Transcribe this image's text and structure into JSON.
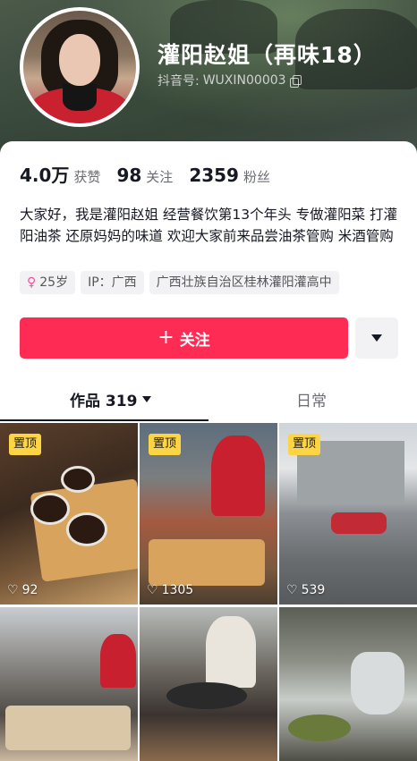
{
  "profile": {
    "name": "灌阳赵姐（再味18）",
    "douyin_id_label": "抖音号:",
    "douyin_id": "WUXIN00003"
  },
  "stats": [
    {
      "value": "4.0万",
      "label": "获赞"
    },
    {
      "value": "98",
      "label": "关注"
    },
    {
      "value": "2359",
      "label": "粉丝"
    }
  ],
  "bio": "大家好，我是灌阳赵姐 经营餐饮第13个年头 专做灌阳菜 打灌阳油茶 还原妈妈的味道 欢迎大家前来品尝油茶管购 米酒管购",
  "tags": {
    "age": "25岁",
    "ip": "IP：广西",
    "location": "广西壮族自治区桂林灌阳灌高中"
  },
  "actions": {
    "follow_label": "关注",
    "plus": "+"
  },
  "tabs": {
    "works_label": "作品 319",
    "daily_label": "日常"
  },
  "grid": {
    "pin_label": "置顶",
    "likes": [
      "92",
      "1305",
      "539"
    ]
  },
  "colors": {
    "accent": "#fe2c55",
    "pin_badge": "#fdd444"
  }
}
